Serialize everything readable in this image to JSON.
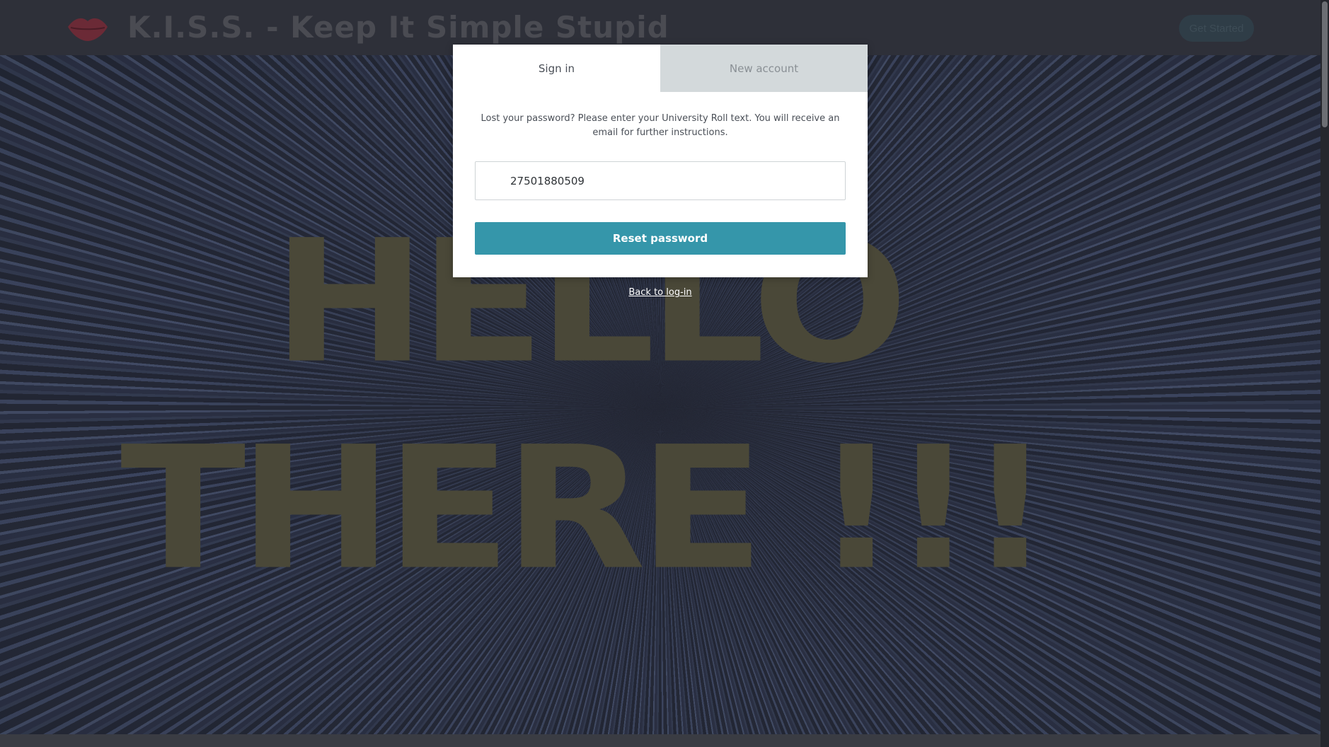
{
  "header": {
    "site_title": "K.I.S.S. - Keep It Simple Stupid",
    "get_started_label": "Get Started",
    "logo_icon": "lips-icon"
  },
  "hero": {
    "line1": "HELLO",
    "line2": "THERE !!!"
  },
  "modal": {
    "tabs": [
      {
        "label": "Sign in",
        "active": true
      },
      {
        "label": "New account",
        "active": false
      }
    ],
    "instructions": "Lost your password? Please enter your University Roll text. You will receive an email for further instructions.",
    "roll_input_value": "27501880509",
    "reset_button_label": "Reset password",
    "back_link_label": "Back to log-in"
  },
  "colors": {
    "accent": "#3596aa",
    "header_bg": "#2e3039",
    "hero_text": "#4a4838"
  }
}
